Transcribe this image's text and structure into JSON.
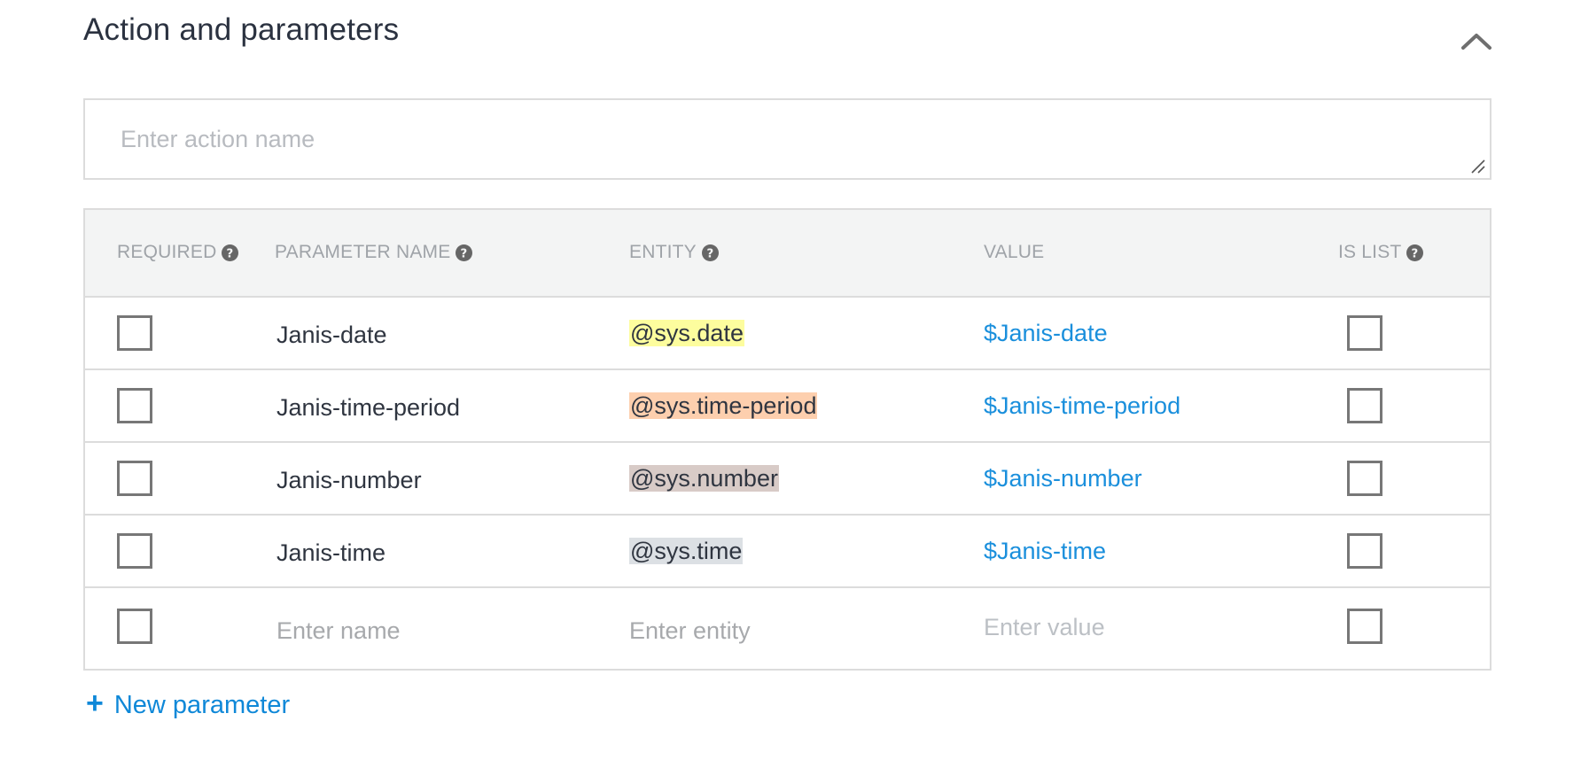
{
  "section": {
    "title": "Action and parameters",
    "collapse_icon": "chevron-up-icon"
  },
  "action_input": {
    "value": "",
    "placeholder": "Enter action name"
  },
  "table": {
    "headers": [
      {
        "label": "REQUIRED",
        "help": true
      },
      {
        "label": "PARAMETER NAME",
        "help": true
      },
      {
        "label": "ENTITY",
        "help": true
      },
      {
        "label": "VALUE",
        "help": false
      },
      {
        "label": "IS LIST",
        "help": true
      }
    ],
    "rows": [
      {
        "required": false,
        "name": "Janis-date",
        "entity": "@sys.date",
        "entity_color": "#fdfd9e",
        "value": "$Janis-date",
        "is_list": false
      },
      {
        "required": false,
        "name": "Janis-time-period",
        "entity": "@sys.time-period",
        "entity_color": "#fdcfae",
        "value": "$Janis-time-period",
        "is_list": false
      },
      {
        "required": false,
        "name": "Janis-number",
        "entity": "@sys.number",
        "entity_color": "#d8cbc7",
        "value": "$Janis-number",
        "is_list": false
      },
      {
        "required": false,
        "name": "Janis-time",
        "entity": "@sys.time",
        "entity_color": "#dce0e4",
        "value": "$Janis-time",
        "is_list": false
      }
    ],
    "new_row": {
      "required": false,
      "name_placeholder": "Enter name",
      "entity_placeholder": "Enter entity",
      "value_placeholder": "Enter value",
      "is_list": false
    }
  },
  "new_parameter": {
    "icon": "plus-icon",
    "plus": "+",
    "label": "New parameter"
  },
  "colors": {
    "link": "#0f88d8",
    "value_text": "#1a8fdc",
    "header_bg": "#f3f4f4",
    "border": "#dcdcdc"
  }
}
